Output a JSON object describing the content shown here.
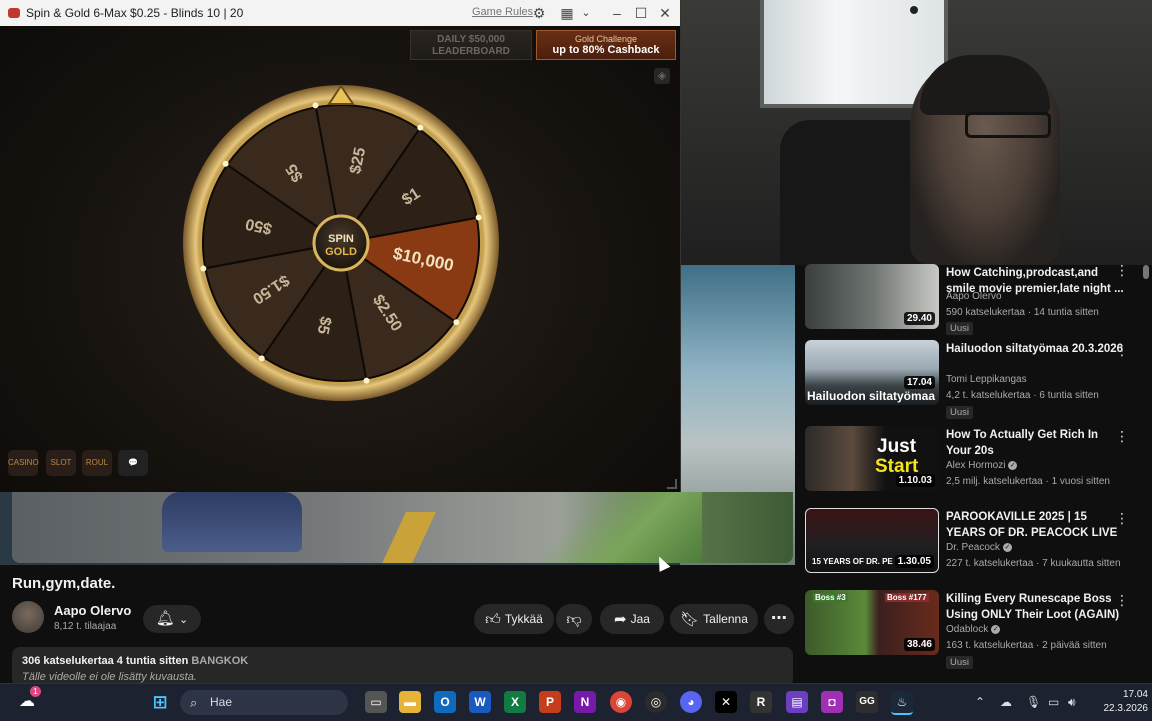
{
  "game_window": {
    "title": "Spin & Gold 6-Max $0.25 - Blinds 10 | 20",
    "rules_link": "Game Rules",
    "leaderboard_line1": "DAILY $50,000",
    "leaderboard_line2": "LEADERBOARD",
    "challenge_line1": "Gold Challenge",
    "challenge_line2": "up to 80% Cashback",
    "wheel_center_line1": "SPIN",
    "wheel_center_line2": "GOLD",
    "wheel_center_amp": "&",
    "wheel_prizes": [
      "$25",
      "$1",
      "$10,000",
      "$2.50",
      "$5",
      "$1.50",
      "$50",
      "$5"
    ]
  },
  "video": {
    "title": "Run,gym,date.",
    "channel_name": "Aapo Olervo",
    "channel_subs": "8,12 t. tilaajaa",
    "like_label": "Tykkää",
    "share_label": "Jaa",
    "save_label": "Tallenna",
    "views_time": "306 katselukertaa  4 tuntia sitten",
    "location": "BANGKOK",
    "no_description": "Tälle videolle ei ole lisätty kuvausta."
  },
  "recommendations": [
    {
      "title": "How Catching,prodcast,and smile movie premier,late night ...",
      "channel": "Aapo Olervo",
      "meta": "590 katselukertaa · 14 tuntia sitten",
      "badge": "Uusi",
      "duration": "29.40",
      "verified": false
    },
    {
      "title": "Hailuodon siltatyömaa 20.3.2026",
      "channel": "Tomi Leppikangas",
      "meta": "4,2 t. katselukertaa · 6 tuntia sitten",
      "badge": "Uusi",
      "duration": "17.04",
      "thumb_text": "Hailuodon siltatyömaa",
      "verified": false
    },
    {
      "title": "How To Actually Get Rich In Your 20s",
      "channel": "Alex Hormozi",
      "meta": "2,5 milj. katselukertaa · 1 vuosi sitten",
      "badge": "",
      "duration": "1.10.03",
      "thumb_text1": "Just",
      "thumb_text2": "Start",
      "verified": true
    },
    {
      "title": "PAROOKAVILLE 2025 | 15 YEARS OF DR. PEACOCK LIVE",
      "channel": "Dr. Peacock",
      "meta": "227 t. katselukertaa · 7 kuukautta sitten",
      "badge": "",
      "duration": "1.30.05",
      "thumb_text": "15 YEARS OF DR. PE",
      "verified": true
    },
    {
      "title": "Killing Every Runescape Boss Using ONLY Their Loot (AGAIN)",
      "channel": "Odablock",
      "meta": "163 t. katselukertaa · 2 päivää sitten",
      "badge": "Uusi",
      "duration": "38.46",
      "thumb_text1": "Boss #3",
      "thumb_text2": "Boss #177",
      "verified": true
    }
  ],
  "taskbar": {
    "search_placeholder": "Hae",
    "time": "17.04",
    "date": "22.3.2026",
    "notification_count": "1"
  },
  "colors": {
    "youtube_bg": "#0f0f0f",
    "pill_bg": "#272727",
    "gold": "#c9a04a",
    "jackpot_segment": "#8a3a12",
    "taskbar_bg": "#1c2230"
  }
}
